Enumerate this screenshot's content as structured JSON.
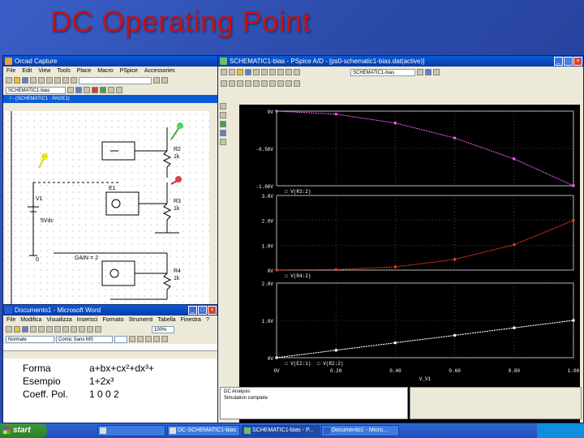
{
  "slide": {
    "title": "DC Operating Point"
  },
  "capture": {
    "title": "Orcad Capture",
    "menu": [
      "File",
      "Edit",
      "View",
      "Tools",
      "Place",
      "Macro",
      "PSpice",
      "Accessories",
      "Options",
      "Window",
      "Help"
    ],
    "schematic_select": "SCHEMATIC1-bias",
    "page_title": "/ - (SCHEMATIC1 : PAGE1)",
    "components": {
      "r2": "R2",
      "r2_val": "1k",
      "r3": "R3",
      "r3_val": "1k",
      "r4": "R4",
      "r4_val": "1k",
      "v1": "V1",
      "v1_val": "5Vdc",
      "e1": "E1",
      "gnd": "0",
      "gain_lbl": "GAIN = 2"
    }
  },
  "word": {
    "title": "Documento1 - Microsoft Word",
    "menu": [
      "File",
      "Modifica",
      "Visualizza",
      "Inserisci",
      "Formato",
      "Strumenti",
      "Tabella",
      "Finestra",
      "?"
    ],
    "style": "Normale",
    "font": "Comic Sans MS",
    "zoom": "100%",
    "rows": [
      {
        "label": "Forma",
        "value": "a+bx+cx²+dx³+"
      },
      {
        "label": "Esempio",
        "value": "1+2x³"
      },
      {
        "label": "Coeff. Pol.",
        "value": "1 0 0 2"
      }
    ]
  },
  "probe": {
    "title": "SCHEMATIC1-bias - PSpice A/D - [ps0-schematic1-bias.dat(active)]",
    "select": "SCHEMATIC1-bias",
    "status_lines": [
      "DC Analysis",
      "Simulation complete"
    ]
  },
  "chart_data": [
    {
      "type": "line",
      "title": "",
      "x": [
        0,
        0.2,
        0.4,
        0.6,
        0.8,
        1.0
      ],
      "xlabel": "V_V1",
      "xticks": [
        "0V",
        "0.20",
        "0.40",
        "0.60",
        "0.80",
        "1.00"
      ],
      "ylim": [
        -1.0,
        0
      ],
      "yticks": [
        "0V",
        "-0.50V",
        "-1.00V"
      ],
      "series": [
        {
          "name": "V(R3:2)",
          "color": "#ff60ff",
          "values": [
            0,
            -0.04,
            -0.16,
            -0.36,
            -0.64,
            -1.0
          ]
        }
      ]
    },
    {
      "type": "line",
      "title": "",
      "x": [
        0,
        0.2,
        0.4,
        0.6,
        0.8,
        1.0
      ],
      "ylim": [
        0,
        3.0
      ],
      "yticks": [
        "0V",
        "1.0V",
        "2.0V",
        "3.0V"
      ],
      "series": [
        {
          "name": "V(R4:2)",
          "color": "#ff4020",
          "values": [
            0,
            0.02,
            0.13,
            0.43,
            1.02,
            2.0
          ]
        }
      ]
    },
    {
      "type": "line",
      "title": "",
      "x": [
        0,
        0.2,
        0.4,
        0.6,
        0.8,
        1.0
      ],
      "ylim": [
        0,
        2.0
      ],
      "yticks": [
        "0V",
        "1.0V",
        "2.0V"
      ],
      "series": [
        {
          "name": "V(E2:1)",
          "color": "#30ff30",
          "values": [
            0,
            0.2,
            0.4,
            0.6,
            0.8,
            1.0
          ]
        },
        {
          "name": "V(R2:2)",
          "color": "#ffffff",
          "values": [
            0,
            0.2,
            0.4,
            0.6,
            0.8,
            1.0
          ]
        }
      ]
    }
  ],
  "taskbar": {
    "start": "start",
    "tasks": [
      "",
      "DC-SCHEMATIC1-bias",
      "SCHEMATIC1-bias - P...",
      "Documento1 - Micro..."
    ],
    "clock": ""
  }
}
